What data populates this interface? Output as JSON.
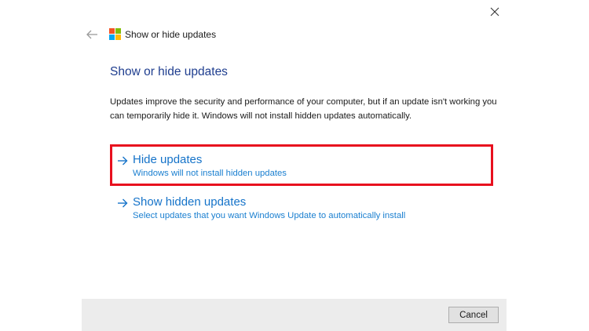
{
  "window": {
    "title": "Show or hide updates"
  },
  "main": {
    "heading": "Show or hide updates",
    "description": "Updates improve the security and performance of your computer, but if an update isn't working you can temporarily hide it. Windows will not install hidden updates automatically.",
    "options": [
      {
        "title": "Hide updates",
        "subtitle": "Windows will not install hidden updates",
        "highlighted": true
      },
      {
        "title": "Show hidden updates",
        "subtitle": "Select updates that you want Windows Update to automatically install",
        "highlighted": false
      }
    ]
  },
  "footer": {
    "cancel_label": "Cancel"
  },
  "icons": {
    "close": "close-icon",
    "back": "back-arrow-icon",
    "app": "windows-logo-icon",
    "option_arrow": "right-arrow-icon"
  },
  "colors": {
    "heading": "#1f3e8f",
    "link": "#1573c9",
    "highlight_border": "#e8101e",
    "footer_bg": "#ececec"
  }
}
